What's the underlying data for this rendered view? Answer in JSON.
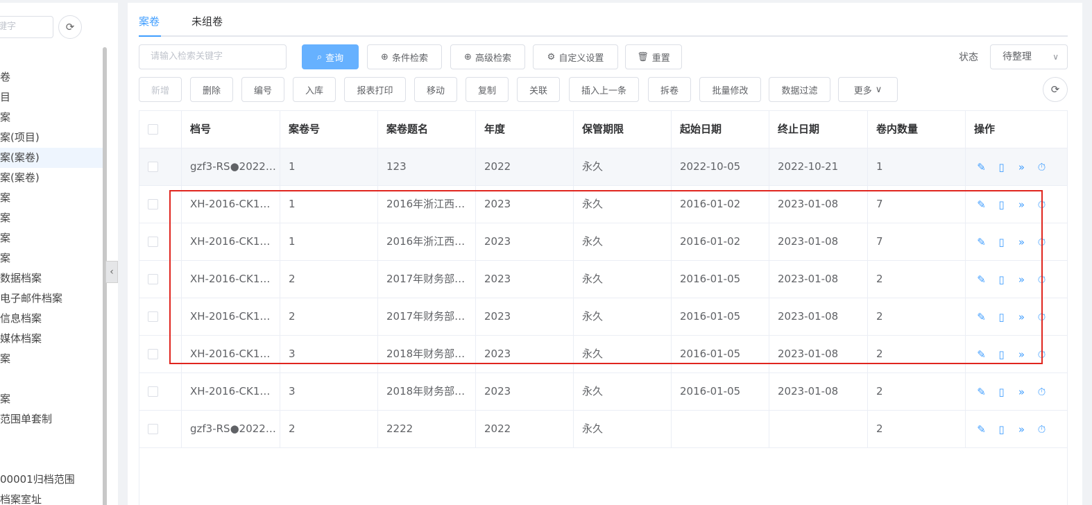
{
  "left": {
    "search_placeholder": "键字",
    "refresh_icon": "refresh-icon",
    "tree": [
      "卷",
      "目",
      "案",
      "案(项目)",
      "案(案卷)",
      "案(案卷)",
      "案",
      "案",
      "案",
      "案",
      "数据档案",
      "电子邮件档案",
      "信息档案",
      "媒体档案",
      "案",
      "",
      "案",
      "范围单套制",
      "",
      "",
      "00001归档范围",
      "档案室址"
    ]
  },
  "tabs": [
    "案卷",
    "未组卷"
  ],
  "search": {
    "placeholder": "请输入检索关键字"
  },
  "toolbar": {
    "query": "查询",
    "condition_search": "条件检索",
    "advanced_search": "高级检索",
    "custom_settings": "自定义设置",
    "reset": "重置"
  },
  "status": {
    "label": "状态",
    "value": "待整理"
  },
  "actions": [
    "新增",
    "删除",
    "编号",
    "入库",
    "报表打印",
    "移动",
    "复制",
    "关联",
    "插入上一条",
    "拆卷",
    "批量修改",
    "数据过滤",
    "更多"
  ],
  "table": {
    "columns": [
      "档号",
      "案卷号",
      "案卷题名",
      "年度",
      "保管期限",
      "起始日期",
      "终止日期",
      "卷内数量",
      "操作"
    ],
    "rows": [
      [
        "gzf3-RS●2022…",
        "1",
        "123",
        "2022",
        "永久",
        "2022-10-05",
        "2022-10-21",
        "1"
      ],
      [
        "XH-2016-CK1…",
        "1",
        "2016年浙江西…",
        "2023",
        "永久",
        "2016-01-02",
        "2023-01-08",
        "7"
      ],
      [
        "XH-2016-CK1…",
        "1",
        "2016年浙江西…",
        "2023",
        "永久",
        "2016-01-02",
        "2023-01-08",
        "7"
      ],
      [
        "XH-2016-CK1…",
        "2",
        "2017年财务部…",
        "2023",
        "永久",
        "2016-01-05",
        "2023-01-08",
        "2"
      ],
      [
        "XH-2016-CK1…",
        "2",
        "2017年财务部…",
        "2023",
        "永久",
        "2016-01-05",
        "2023-01-08",
        "2"
      ],
      [
        "XH-2016-CK1…",
        "3",
        "2018年财务部…",
        "2023",
        "永久",
        "2016-01-05",
        "2023-01-08",
        "2"
      ],
      [
        "XH-2016-CK1…",
        "3",
        "2018年财务部…",
        "2023",
        "永久",
        "2016-01-05",
        "2023-01-08",
        "2"
      ],
      [
        "gzf3-RS●2022…",
        "2",
        "2222",
        "2022",
        "永久",
        "",
        "",
        "2"
      ]
    ],
    "op_icons": [
      "edit-icon",
      "book-icon",
      "forward-icon",
      "timer-icon"
    ]
  },
  "colors": {
    "primary": "#409eff",
    "highlight": "#e0251e"
  }
}
